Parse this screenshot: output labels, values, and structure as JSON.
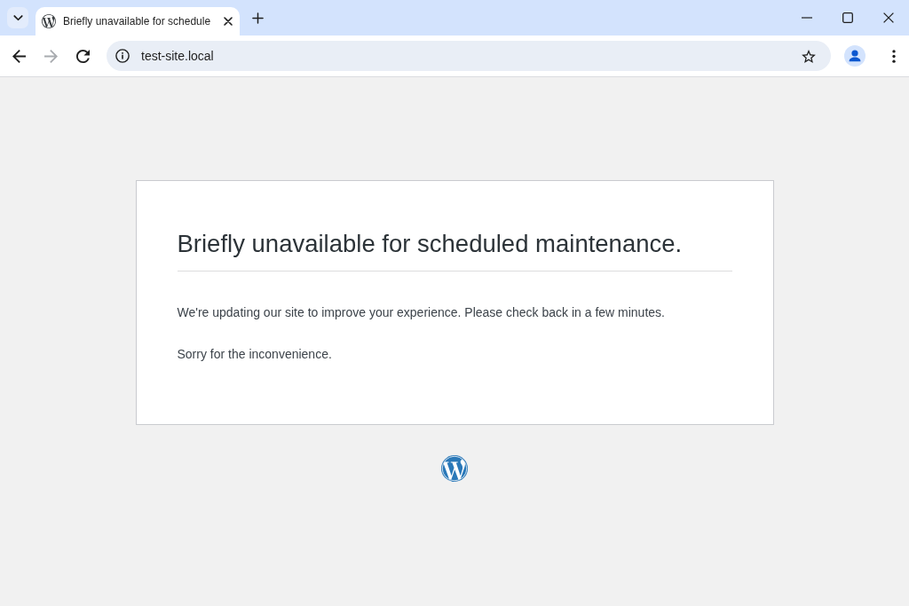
{
  "browser": {
    "tabs": [
      {
        "title": "Briefly unavailable for schedule",
        "selected": true
      }
    ],
    "navigation": [
      {
        "kind": "back",
        "disabled": false
      },
      {
        "kind": "forward",
        "disabled": true
      },
      {
        "kind": "reload",
        "disabled": false
      }
    ],
    "address": "test-site.local"
  },
  "page": {
    "heading": "Briefly unavailable for scheduled maintenance.",
    "paragraphs": [
      "We're updating our site to improve your experience. Please check back in a few minutes.",
      "Sorry for the inconvenience."
    ]
  }
}
